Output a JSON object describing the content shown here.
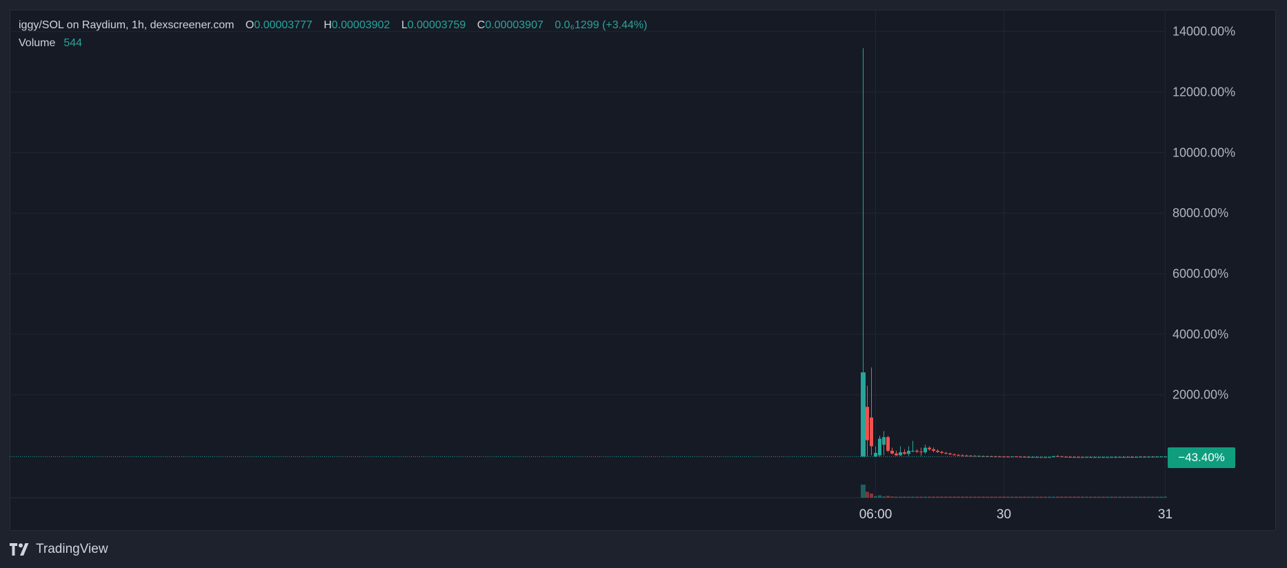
{
  "legend": {
    "symbol": "iggy/SOL on Raydium, 1h, dexscreener.com",
    "open_key": "O",
    "open_value": "0.00003777",
    "high_key": "H",
    "high_value": "0.00003902",
    "low_key": "L",
    "low_value": "0.00003759",
    "close_key": "C",
    "close_value": "0.00003907",
    "change": "0.0₆1299 (+3.44%)",
    "volume_key": "Volume",
    "volume_value": "544"
  },
  "current_badge": "−43.40%",
  "brand": {
    "name": "TradingView",
    "logo_icon": "tradingview-logo-icon"
  },
  "colors": {
    "up": "#26a69a",
    "down": "#ef5350",
    "background": "#161a25",
    "grid": "#222631",
    "badge": "#0f9d7e"
  },
  "chart_data": {
    "type": "candlestick",
    "y_axis_unit": "%",
    "y_axis_side": "right",
    "ylim": [
      -1400,
      14700
    ],
    "y_ticks": [
      2000,
      4000,
      6000,
      8000,
      10000,
      12000,
      14000
    ],
    "y_tick_labels": [
      "2000.00%",
      "4000.00%",
      "6000.00%",
      "8000.00%",
      "10000.00%",
      "12000.00%",
      "14000.00%"
    ],
    "x_tick_labels": [
      "06:00",
      "30",
      "31"
    ],
    "x_tick_bar_index": [
      3,
      34,
      73
    ],
    "total_bars": 160,
    "last_value": -43.4,
    "grid": true,
    "candles": [
      {
        "o": -43,
        "h": 13450,
        "l": -43,
        "c": 2740,
        "v": 1.0
      },
      {
        "o": 1600,
        "h": 2300,
        "l": -43,
        "c": 500,
        "v": 0.45
      },
      {
        "o": 1250,
        "h": 2900,
        "l": 0,
        "c": 300,
        "v": 0.32
      },
      {
        "o": -43,
        "h": 300,
        "l": -43,
        "c": 80,
        "v": 0.12
      },
      {
        "o": 0,
        "h": 650,
        "l": -43,
        "c": 550,
        "v": 0.18
      },
      {
        "o": 350,
        "h": 800,
        "l": 0,
        "c": 600,
        "v": 0.1
      },
      {
        "o": 600,
        "h": 650,
        "l": 100,
        "c": 150,
        "v": 0.14
      },
      {
        "o": 150,
        "h": 250,
        "l": 30,
        "c": 60,
        "v": 0.09
      },
      {
        "o": 60,
        "h": 150,
        "l": -20,
        "c": 0,
        "v": 0.07
      },
      {
        "o": 0,
        "h": 300,
        "l": -20,
        "c": 100,
        "v": 0.06
      },
      {
        "o": 100,
        "h": 200,
        "l": 20,
        "c": 50,
        "v": 0.05
      },
      {
        "o": 50,
        "h": 300,
        "l": -20,
        "c": 150,
        "v": 0.05
      },
      {
        "o": 150,
        "h": 480,
        "l": 100,
        "c": 150,
        "v": 0.05
      },
      {
        "o": 150,
        "h": 200,
        "l": 80,
        "c": 120,
        "v": 0.04
      },
      {
        "o": 120,
        "h": 250,
        "l": -20,
        "c": 100,
        "v": 0.04
      },
      {
        "o": 100,
        "h": 350,
        "l": 50,
        "c": 250,
        "v": 0.05
      },
      {
        "o": 250,
        "h": 300,
        "l": 150,
        "c": 200,
        "v": 0.04
      },
      {
        "o": 200,
        "h": 260,
        "l": 100,
        "c": 150,
        "v": 0.04
      },
      {
        "o": 150,
        "h": 200,
        "l": 80,
        "c": 110,
        "v": 0.03
      },
      {
        "o": 110,
        "h": 150,
        "l": 50,
        "c": 80,
        "v": 0.03
      },
      {
        "o": 80,
        "h": 120,
        "l": 30,
        "c": 60,
        "v": 0.03
      },
      {
        "o": 60,
        "h": 90,
        "l": 10,
        "c": 30,
        "v": 0.03
      },
      {
        "o": 30,
        "h": 60,
        "l": -10,
        "c": 10,
        "v": 0.03
      },
      {
        "o": 10,
        "h": 40,
        "l": -20,
        "c": 0,
        "v": 0.03
      },
      {
        "o": 0,
        "h": 30,
        "l": -30,
        "c": -10,
        "v": 0.02
      },
      {
        "o": -10,
        "h": 20,
        "l": -30,
        "c": -15,
        "v": 0.02
      },
      {
        "o": -15,
        "h": 10,
        "l": -35,
        "c": -20,
        "v": 0.02
      },
      {
        "o": -20,
        "h": 5,
        "l": -35,
        "c": -25,
        "v": 0.02
      },
      {
        "o": -25,
        "h": 0,
        "l": -40,
        "c": -30,
        "v": 0.02
      },
      {
        "o": -30,
        "h": -5,
        "l": -45,
        "c": -32,
        "v": 0.02
      },
      {
        "o": -32,
        "h": -10,
        "l": -45,
        "c": -35,
        "v": 0.02
      },
      {
        "o": -35,
        "h": -15,
        "l": -50,
        "c": -38,
        "v": 0.02
      },
      {
        "o": -38,
        "h": -20,
        "l": -50,
        "c": -40,
        "v": 0.02
      },
      {
        "o": -40,
        "h": -20,
        "l": -50,
        "c": -42,
        "v": 0.02
      },
      {
        "o": -42,
        "h": -25,
        "l": -55,
        "c": -45,
        "v": 0.02
      },
      {
        "o": -45,
        "h": -30,
        "l": -60,
        "c": -50,
        "v": 0.02
      },
      {
        "o": -50,
        "h": -30,
        "l": -60,
        "c": -40,
        "v": 0.02
      },
      {
        "o": -40,
        "h": -25,
        "l": -55,
        "c": -45,
        "v": 0.02
      },
      {
        "o": -45,
        "h": -30,
        "l": -60,
        "c": -50,
        "v": 0.02
      },
      {
        "o": -50,
        "h": -30,
        "l": -65,
        "c": -55,
        "v": 0.02
      },
      {
        "o": -55,
        "h": -35,
        "l": -70,
        "c": -60,
        "v": 0.02
      },
      {
        "o": -60,
        "h": -40,
        "l": -70,
        "c": -58,
        "v": 0.02
      },
      {
        "o": -58,
        "h": -40,
        "l": -70,
        "c": -62,
        "v": 0.02
      },
      {
        "o": -62,
        "h": -45,
        "l": -75,
        "c": -65,
        "v": 0.02
      },
      {
        "o": -65,
        "h": -45,
        "l": -80,
        "c": -70,
        "v": 0.02
      },
      {
        "o": -70,
        "h": -50,
        "l": -85,
        "c": -60,
        "v": 0.02
      },
      {
        "o": -60,
        "h": -20,
        "l": -70,
        "c": -30,
        "v": 0.03
      },
      {
        "o": -30,
        "h": 10,
        "l": -50,
        "c": -40,
        "v": 0.03
      },
      {
        "o": -40,
        "h": -20,
        "l": -60,
        "c": -50,
        "v": 0.02
      },
      {
        "o": -50,
        "h": -30,
        "l": -65,
        "c": -55,
        "v": 0.02
      },
      {
        "o": -55,
        "h": -35,
        "l": -70,
        "c": -58,
        "v": 0.02
      },
      {
        "o": -58,
        "h": -40,
        "l": -70,
        "c": -60,
        "v": 0.02
      },
      {
        "o": -60,
        "h": -40,
        "l": -72,
        "c": -62,
        "v": 0.02
      },
      {
        "o": -62,
        "h": -45,
        "l": -75,
        "c": -64,
        "v": 0.02
      },
      {
        "o": -64,
        "h": -45,
        "l": -75,
        "c": -60,
        "v": 0.02
      },
      {
        "o": -60,
        "h": -45,
        "l": -72,
        "c": -63,
        "v": 0.02
      },
      {
        "o": -63,
        "h": -45,
        "l": -75,
        "c": -65,
        "v": 0.02
      },
      {
        "o": -65,
        "h": -45,
        "l": -78,
        "c": -62,
        "v": 0.02
      },
      {
        "o": -62,
        "h": -45,
        "l": -75,
        "c": -66,
        "v": 0.02
      },
      {
        "o": -66,
        "h": -48,
        "l": -78,
        "c": -64,
        "v": 0.02
      },
      {
        "o": -64,
        "h": -45,
        "l": -76,
        "c": -60,
        "v": 0.02
      },
      {
        "o": -60,
        "h": -40,
        "l": -72,
        "c": -62,
        "v": 0.02
      },
      {
        "o": -62,
        "h": -45,
        "l": -75,
        "c": -58,
        "v": 0.02
      },
      {
        "o": -58,
        "h": -40,
        "l": -70,
        "c": -60,
        "v": 0.02
      },
      {
        "o": -60,
        "h": -40,
        "l": -72,
        "c": -56,
        "v": 0.02
      },
      {
        "o": -56,
        "h": -35,
        "l": -68,
        "c": -58,
        "v": 0.02
      },
      {
        "o": -58,
        "h": -40,
        "l": -70,
        "c": -55,
        "v": 0.02
      },
      {
        "o": -55,
        "h": -30,
        "l": -65,
        "c": -50,
        "v": 0.02
      },
      {
        "o": -50,
        "h": -30,
        "l": -62,
        "c": -52,
        "v": 0.02
      },
      {
        "o": -52,
        "h": -32,
        "l": -64,
        "c": -48,
        "v": 0.02
      },
      {
        "o": -48,
        "h": -30,
        "l": -60,
        "c": -50,
        "v": 0.02
      },
      {
        "o": -50,
        "h": -30,
        "l": -62,
        "c": -46,
        "v": 0.02
      },
      {
        "o": -46,
        "h": -30,
        "l": -58,
        "c": -44,
        "v": 0.02
      },
      {
        "o": -45,
        "h": -36,
        "l": -46,
        "c": -43.4,
        "v": 0.02
      }
    ]
  }
}
